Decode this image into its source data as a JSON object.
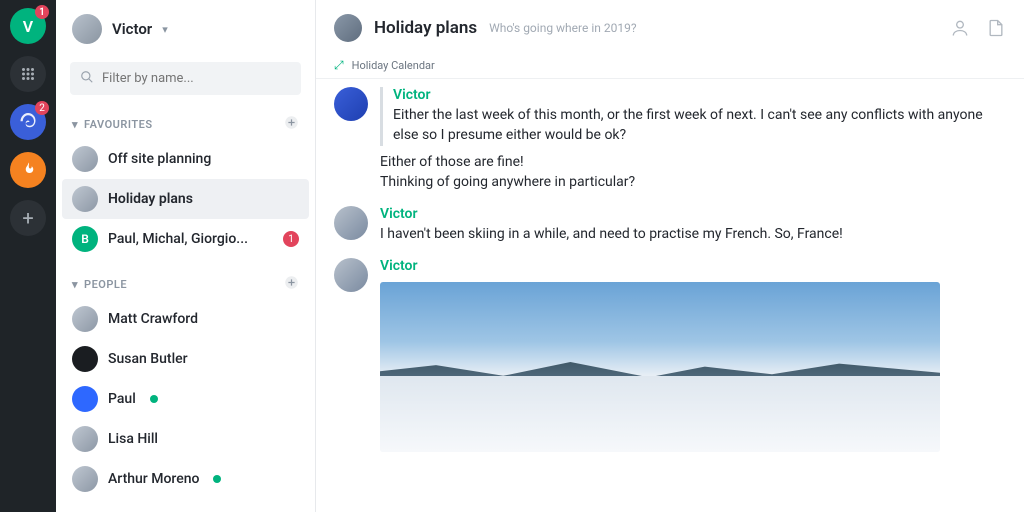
{
  "rail": {
    "items": [
      {
        "kind": "avatar",
        "label": "V",
        "badge": "1"
      },
      {
        "kind": "dots"
      },
      {
        "kind": "blue",
        "badge": "2"
      },
      {
        "kind": "orange"
      },
      {
        "kind": "add",
        "label": "+"
      }
    ]
  },
  "sidebar": {
    "user": "Victor",
    "search_placeholder": "Filter by name...",
    "favourites_label": "FAVOURITES",
    "favourites": [
      {
        "name": "Off site planning"
      },
      {
        "name": "Holiday plans",
        "active": true
      },
      {
        "name": "Paul, Michal, Giorgio...",
        "badge": "1",
        "avatar_letter": "B",
        "avatar_color": "teal"
      }
    ],
    "people_label": "PEOPLE",
    "people": [
      {
        "name": "Matt Crawford"
      },
      {
        "name": "Susan Butler",
        "dark": true
      },
      {
        "name": "Paul",
        "online": true,
        "blue": true
      },
      {
        "name": "Lisa Hill"
      },
      {
        "name": "Arthur Moreno",
        "online": true
      }
    ]
  },
  "header": {
    "title": "Holiday plans",
    "subtitle": "Who's going where in 2019?",
    "calendar_label": "Holiday Calendar"
  },
  "messages": [
    {
      "author": "Victor",
      "quoted": {
        "author": "Victor",
        "text": "Either the last week of this month, or the first week of next. I can't see any conflicts with anyone else so I presume either would be ok?"
      },
      "lines": [
        "Either of those are fine!",
        "Thinking of going anywhere in particular?"
      ]
    },
    {
      "author": "Victor",
      "lines": [
        "I haven't been skiing in a while, and need to practise my French. So, France!"
      ]
    },
    {
      "author": "Victor",
      "image": true
    }
  ]
}
